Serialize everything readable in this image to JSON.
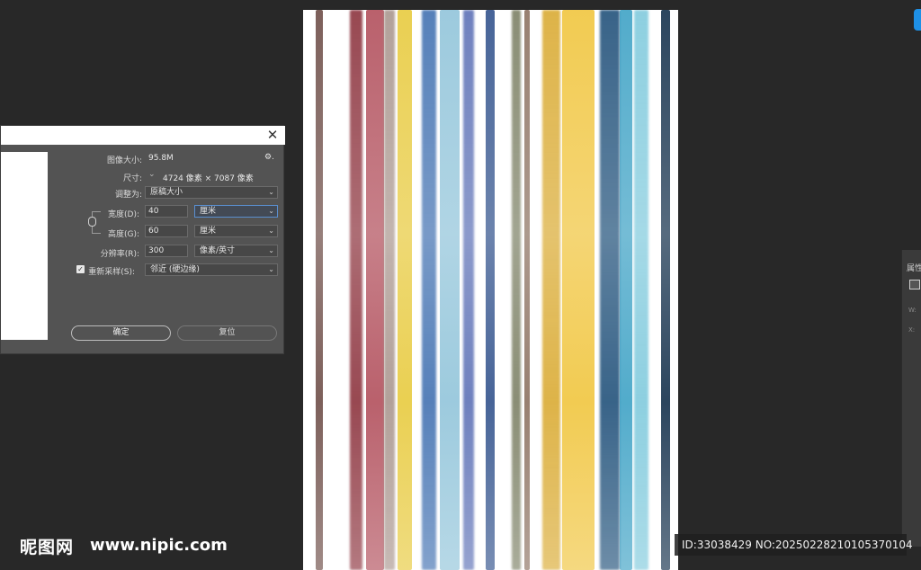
{
  "dialog": {
    "close_glyph": "✕",
    "image_size_label": "图像大小:",
    "image_size_value": "95.8M",
    "dimensions_label": "尺寸:",
    "dimensions_value": "4724 像素 × 7087 像素",
    "fit_to_label": "调整为:",
    "fit_to_value": "原稿大小",
    "width_label": "宽度(D):",
    "width_value": "40",
    "width_unit": "厘米",
    "height_label": "高度(G):",
    "height_value": "60",
    "height_unit": "厘米",
    "resolution_label": "分辨率(R):",
    "resolution_value": "300",
    "resolution_unit": "像素/英寸",
    "resample_label": "重新采样(S):",
    "resample_checked": true,
    "resample_value": "邻近 (硬边缘)",
    "ok_button": "确定",
    "reset_button": "复位",
    "chevron_glyph": "⌄",
    "check_glyph": "✓",
    "gear_glyph": "⚙."
  },
  "properties_panel": {
    "title": "属性",
    "sub_w": "W:",
    "sub_x": "X:"
  },
  "watermark": {
    "logo": "昵图网",
    "url": "www.nipic.com",
    "id_text": "ID:33038429 NO:20250228210105370104"
  },
  "canvas_stripes": [
    {
      "color": "#6b4a44"
    },
    {
      "color": "#8a2f3a"
    },
    {
      "color": "#b04b58"
    },
    {
      "color": "#a8948c"
    },
    {
      "color": "#e7c93a"
    },
    {
      "color": "#3f6fb0"
    },
    {
      "color": "#8fc3d9"
    },
    {
      "color": "#5b6fb5"
    },
    {
      "color": "#2e4f8a"
    },
    {
      "color": "#7a7e62"
    },
    {
      "color": "#8a6f5e"
    },
    {
      "color": "#d9a92f"
    },
    {
      "color": "#f0c43a"
    },
    {
      "color": "#1d4e78"
    },
    {
      "color": "#3aa0c4"
    },
    {
      "color": "#7ec9dc"
    },
    {
      "color": "#0f2c48"
    }
  ]
}
